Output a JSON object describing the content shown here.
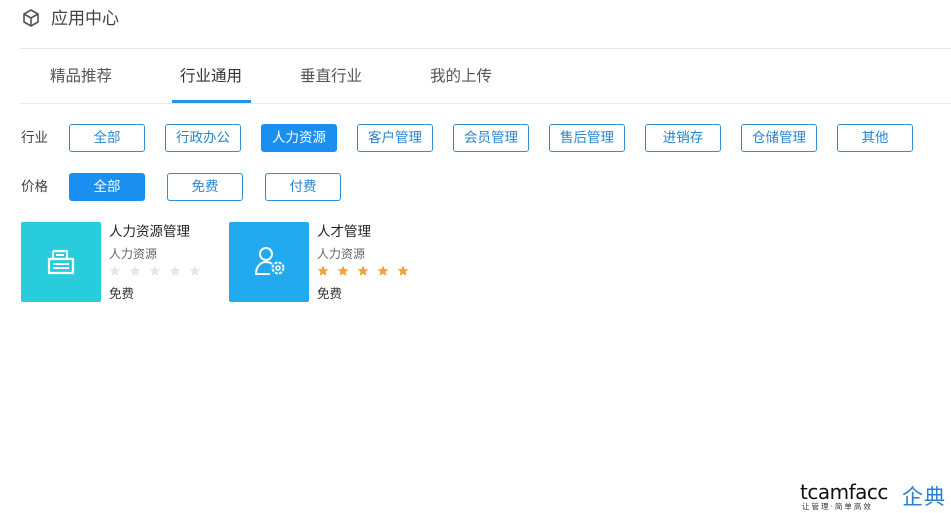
{
  "header": {
    "title": "应用中心",
    "icon": "cube-icon"
  },
  "tabs": [
    {
      "label": "精品推荐",
      "active": false
    },
    {
      "label": "行业通用",
      "active": true
    },
    {
      "label": "垂直行业",
      "active": false
    },
    {
      "label": "我的上传",
      "active": false
    }
  ],
  "filters": {
    "industry": {
      "label": "行业",
      "options": [
        "全部",
        "行政办公",
        "人力资源",
        "客户管理",
        "会员管理",
        "售后管理",
        "进销存",
        "仓储管理",
        "其他"
      ],
      "selected": "人力资源"
    },
    "price": {
      "label": "价格",
      "options": [
        "全部",
        "免费",
        "付费"
      ],
      "selected": "全部"
    }
  },
  "apps": [
    {
      "name": "人力资源管理",
      "category": "人力资源",
      "rating": 0,
      "max_rating": 5,
      "price": "免费",
      "tile_color": "#29ccdc",
      "icon": "document-stack-icon"
    },
    {
      "name": "人才管理",
      "category": "人力资源",
      "rating": 5,
      "max_rating": 5,
      "price": "免费",
      "tile_color": "#22aaf0",
      "icon": "user-gear-icon"
    }
  ],
  "colors": {
    "accent": "#1a8ff0",
    "chip_border": "#2c8fd8",
    "star_filled": "#f0a23a",
    "star_empty": "#e6e6e6"
  },
  "watermark": {
    "brand": "tcamfacc",
    "slogan": "让管理·简单高效",
    "cn": "企典"
  }
}
